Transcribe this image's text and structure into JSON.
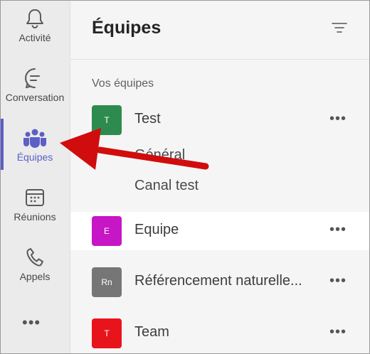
{
  "rail": {
    "items": [
      {
        "label": "Activité",
        "icon": "bell-icon"
      },
      {
        "label": "Conversation",
        "icon": "chat-icon"
      },
      {
        "label": "Équipes",
        "icon": "teams-icon"
      },
      {
        "label": "Réunions",
        "icon": "calendar-icon"
      },
      {
        "label": "Appels",
        "icon": "phone-icon"
      }
    ],
    "more": "•••"
  },
  "header": {
    "title": "Équipes"
  },
  "section_label": "Vos équipes",
  "teams": [
    {
      "initials": "T",
      "name": "Test",
      "color": "#2e8b4f",
      "more": "•••"
    },
    {
      "initials": "E",
      "name": "Equipe",
      "color": "#c616c6",
      "more": "•••"
    },
    {
      "initials": "Rn",
      "name": "Référencement naturelle...",
      "color": "#767676",
      "more": "•••"
    },
    {
      "initials": "T",
      "name": "Team",
      "color": "#e8141c",
      "more": "•••"
    }
  ],
  "channels": [
    "Général",
    "Canal test"
  ],
  "colors": {
    "accent": "#5b5fc7",
    "arrow": "#d10c0c"
  }
}
